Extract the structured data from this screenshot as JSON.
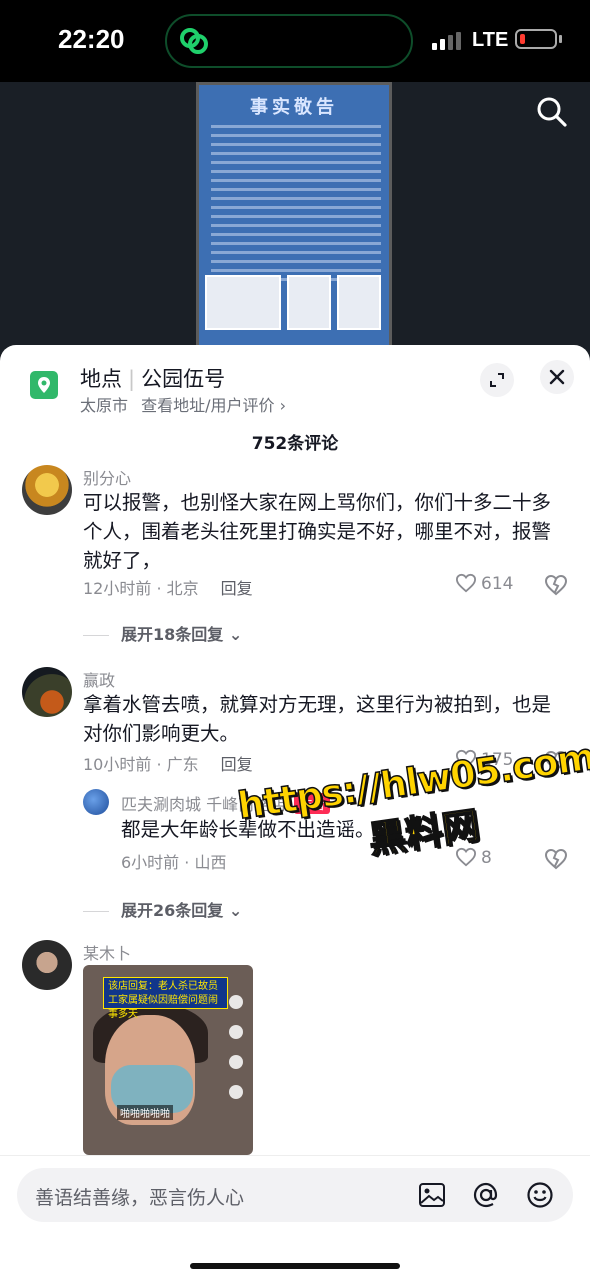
{
  "status_bar": {
    "time": "22:20",
    "network": "LTE"
  },
  "poster": {
    "title": "事实敬告"
  },
  "location": {
    "label": "地点",
    "name": "公园伍号",
    "city": "太原市",
    "link": "查看地址/用户评价 ›"
  },
  "comments_header": {
    "count_text": "752条评论"
  },
  "comments": [
    {
      "user": "别分心",
      "text": "可以报警，也别怪大家在网上骂你们，你们十多二十多个人，围着老头往死里打确实是不好，哪里不对，报警就好了，",
      "meta": "12小时前 · 北京",
      "reply": "回复",
      "likes": "614",
      "expand": "展开18条回复 ⌄"
    },
    {
      "user": "赢政",
      "text": "拿着水管去喷，就算对方无理，这里行为被拍到，也是对你们影响更大。",
      "meta": "10小时前 · 广东",
      "reply": "回复",
      "likes": "175",
      "sub_reply": {
        "user": "匹夫涮肉城 千峰南路店",
        "badge": "作者",
        "text": "都是大年龄长辈做不出造谣。",
        "meta": "6小时前 · 山西",
        "likes": "8"
      },
      "expand": "展开26条回复 ⌄"
    },
    {
      "user": "某木卜",
      "video": {
        "banner": "该店回复：老人杀已故员工家属疑似因赔偿问题闹事多天",
        "caption": "啪啪啪啪啪"
      }
    }
  ],
  "watermark": {
    "url": "https://hlw05.com",
    "name": "黑料网"
  },
  "input": {
    "placeholder": "善语结善缘，恶言伤人心"
  }
}
